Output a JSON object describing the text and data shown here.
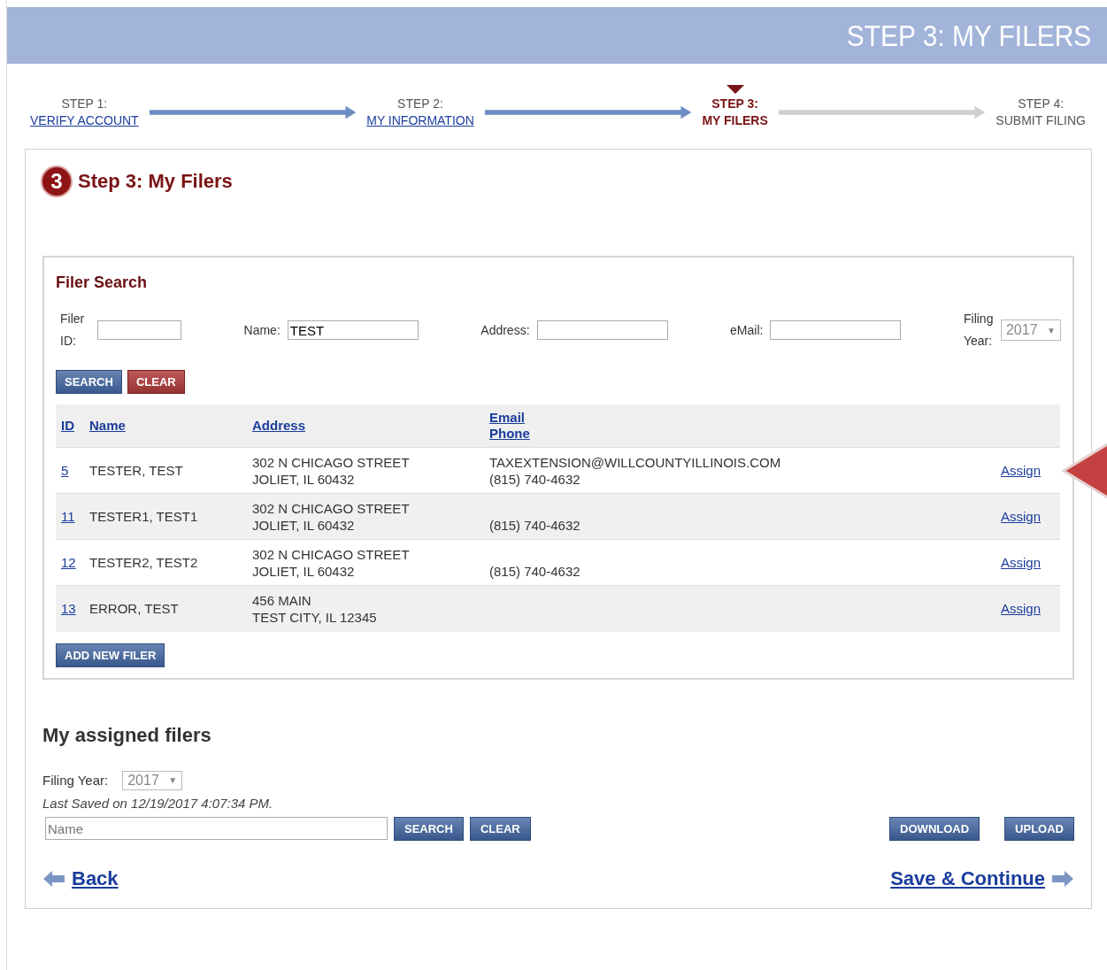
{
  "header": {
    "title": "STEP 3: MY FILERS"
  },
  "steps": [
    {
      "label": "STEP 1:",
      "link": "VERIFY ACCOUNT",
      "done": true,
      "selected": false
    },
    {
      "label": "STEP 2:",
      "link": "MY INFORMATION",
      "done": true,
      "selected": false
    },
    {
      "label": "STEP 3:",
      "link": "MY FILERS",
      "done": true,
      "selected": true
    },
    {
      "label": "STEP 4:",
      "link": "SUBMIT FILING",
      "done": false,
      "selected": false
    }
  ],
  "page": {
    "step_number": "3",
    "title": "Step 3: My Filers"
  },
  "filer_search": {
    "title": "Filer Search",
    "fields": [
      {
        "kind": "text",
        "label": "Filer ID:"
      },
      {
        "kind": "text",
        "label": "Name:",
        "value": "TEST"
      },
      {
        "kind": "text",
        "label": "Address:"
      },
      {
        "kind": "text",
        "label": "eMail:"
      },
      {
        "kind": "select",
        "label": "Filing Year:",
        "value": "2017",
        "caret": "▼"
      }
    ],
    "buttons": [
      {
        "label": "SEARCH",
        "kind": "primary"
      },
      {
        "label": "CLEAR",
        "kind": "danger"
      }
    ],
    "table": {
      "columns": [
        "ID",
        "Name",
        "Address",
        [
          "Email",
          "Phone"
        ]
      ],
      "rows": [
        {
          "id": "5",
          "name": "TESTER, TEST",
          "address": [
            "302 N CHICAGO STREET",
            "JOLIET, IL 60432"
          ],
          "email": "TAXEXTENSION@WILLCOUNTYILLINOIS.COM",
          "phone": "(815) 740-4632",
          "action": "Assign",
          "pointed": true
        },
        {
          "id": "11",
          "name": "TESTER1, TEST1",
          "address": [
            "302 N CHICAGO STREET",
            "JOLIET, IL 60432"
          ],
          "phone": "(815) 740-4632",
          "action": "Assign",
          "pointed": false
        },
        {
          "id": "12",
          "name": "TESTER2, TEST2",
          "address": [
            "302 N CHICAGO STREET",
            "JOLIET, IL 60432"
          ],
          "phone": "(815) 740-4632",
          "action": "Assign",
          "pointed": false
        },
        {
          "id": "13",
          "name": "ERROR, TEST",
          "address": [
            "456 MAIN",
            "TEST CITY, IL 12345"
          ],
          "action": "Assign",
          "pointed": false
        }
      ]
    },
    "add_button": "ADD NEW FILER"
  },
  "assigned": {
    "title": "My assigned filers",
    "filing_year_label": "Filing Year:",
    "filing_year": "2017",
    "filing_year_caret": "▼",
    "last_saved": "Last Saved on 12/19/2017 4:07:34 PM.",
    "name_placeholder": "Name",
    "buttons": [
      "SEARCH",
      "CLEAR"
    ],
    "right_buttons": [
      "DOWNLOAD",
      "UPLOAD"
    ]
  },
  "nav": {
    "back": "Back",
    "next": "Save & Continue"
  }
}
